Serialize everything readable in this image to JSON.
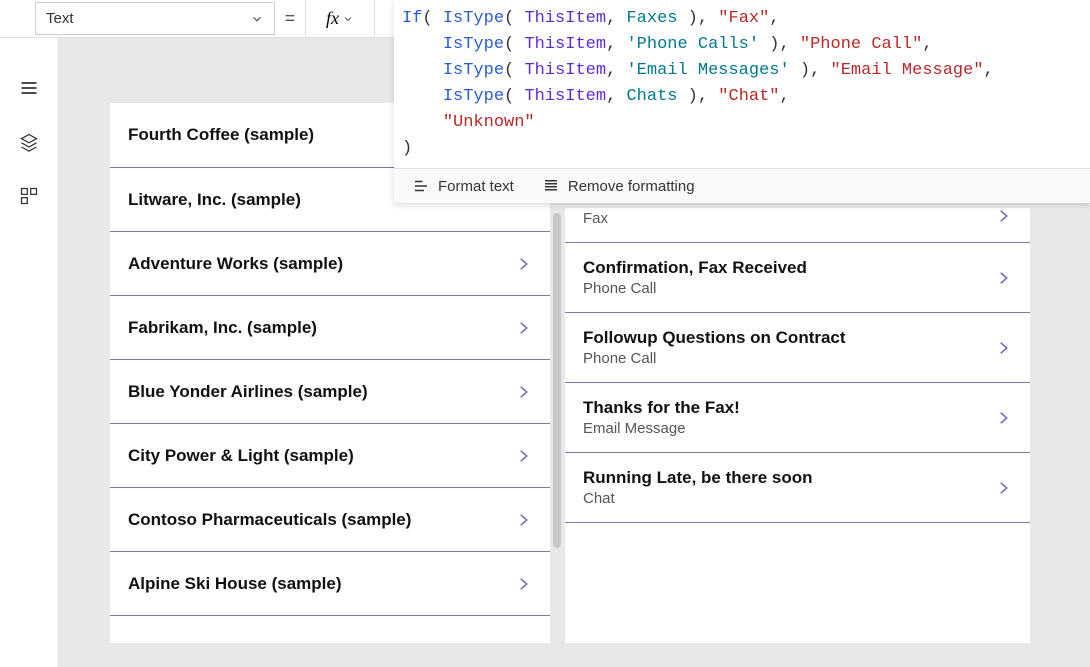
{
  "propertySelector": {
    "value": "Text"
  },
  "equals": "=",
  "fx": "fx",
  "formula": {
    "tokens": [
      [
        {
          "c": "tk-fn",
          "t": "If"
        },
        {
          "c": "tk-p",
          "t": "( "
        },
        {
          "c": "tk-fn",
          "t": "IsType"
        },
        {
          "c": "tk-p",
          "t": "( "
        },
        {
          "c": "tk-obj",
          "t": "ThisItem"
        },
        {
          "c": "tk-p",
          "t": ", "
        },
        {
          "c": "tk-kw",
          "t": "Faxes"
        },
        {
          "c": "tk-p",
          "t": " ), "
        },
        {
          "c": "tk-str",
          "t": "\"Fax\""
        },
        {
          "c": "tk-p",
          "t": ","
        }
      ],
      [
        {
          "c": "tk-p",
          "t": "    "
        },
        {
          "c": "tk-fn",
          "t": "IsType"
        },
        {
          "c": "tk-p",
          "t": "( "
        },
        {
          "c": "tk-obj",
          "t": "ThisItem"
        },
        {
          "c": "tk-p",
          "t": ", "
        },
        {
          "c": "tk-kw",
          "t": "'Phone Calls'"
        },
        {
          "c": "tk-p",
          "t": " ), "
        },
        {
          "c": "tk-str",
          "t": "\"Phone Call\""
        },
        {
          "c": "tk-p",
          "t": ","
        }
      ],
      [
        {
          "c": "tk-p",
          "t": "    "
        },
        {
          "c": "tk-fn",
          "t": "IsType"
        },
        {
          "c": "tk-p",
          "t": "( "
        },
        {
          "c": "tk-obj",
          "t": "ThisItem"
        },
        {
          "c": "tk-p",
          "t": ", "
        },
        {
          "c": "tk-kw",
          "t": "'Email Messages'"
        },
        {
          "c": "tk-p",
          "t": " ), "
        },
        {
          "c": "tk-str",
          "t": "\"Email Message\""
        },
        {
          "c": "tk-p",
          "t": ","
        }
      ],
      [
        {
          "c": "tk-p",
          "t": "    "
        },
        {
          "c": "tk-fn",
          "t": "IsType"
        },
        {
          "c": "tk-p",
          "t": "( "
        },
        {
          "c": "tk-obj",
          "t": "ThisItem"
        },
        {
          "c": "tk-p",
          "t": ", "
        },
        {
          "c": "tk-kw",
          "t": "Chats"
        },
        {
          "c": "tk-p",
          "t": " ), "
        },
        {
          "c": "tk-str",
          "t": "\"Chat\""
        },
        {
          "c": "tk-p",
          "t": ","
        }
      ],
      [
        {
          "c": "tk-p",
          "t": "    "
        },
        {
          "c": "tk-str",
          "t": "\"Unknown\""
        }
      ],
      [
        {
          "c": "tk-p",
          "t": ")"
        }
      ]
    ]
  },
  "formulaToolbar": {
    "formatText": "Format text",
    "removeFormatting": "Remove formatting"
  },
  "leftGallery": {
    "items": [
      {
        "title": "Fourth Coffee (sample)"
      },
      {
        "title": "Litware, Inc. (sample)"
      },
      {
        "title": "Adventure Works (sample)"
      },
      {
        "title": "Fabrikam, Inc. (sample)"
      },
      {
        "title": "Blue Yonder Airlines (sample)"
      },
      {
        "title": "City Power & Light (sample)"
      },
      {
        "title": "Contoso Pharmaceuticals (sample)"
      },
      {
        "title": "Alpine Ski House (sample)"
      }
    ]
  },
  "rightGalleryPartial": {
    "sub": "Fax"
  },
  "rightGallery": {
    "items": [
      {
        "title": "Confirmation, Fax Received",
        "sub": "Phone Call"
      },
      {
        "title": "Followup Questions on Contract",
        "sub": "Phone Call"
      },
      {
        "title": "Thanks for the Fax!",
        "sub": "Email Message"
      },
      {
        "title": "Running Late, be there soon",
        "sub": "Chat"
      }
    ]
  }
}
